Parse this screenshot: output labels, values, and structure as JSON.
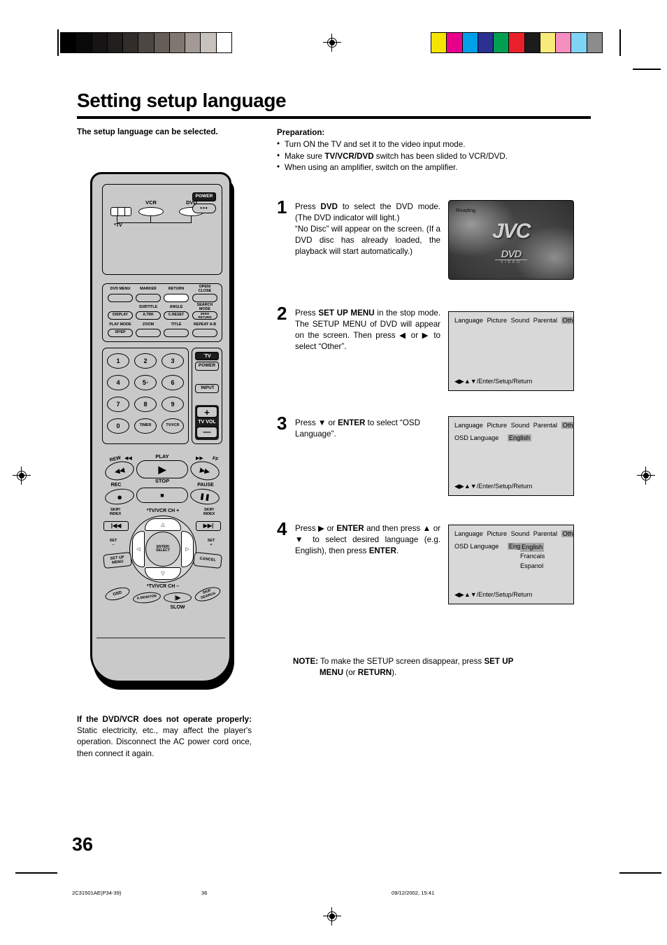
{
  "page": {
    "title": "Setting setup language",
    "subtitle": "The setup language can be selected.",
    "number": "36"
  },
  "preparation": {
    "heading": "Preparation:",
    "items": [
      "Turn ON the TV and set it to the video input mode.",
      "Make sure TV/VCR/DVD switch has been slided to VCR/DVD.",
      "When using an amplifier, switch on the amplifier."
    ]
  },
  "steps": [
    {
      "number": "1",
      "text": "Press DVD to select the DVD mode. (The DVD indicator will light.) “No Disc” will appear on the screen. (If a DVD disc has already loaded, the playback will start automatically.)"
    },
    {
      "number": "2",
      "text": "Press SET UP MENU in the stop mode. The SETUP MENU of DVD will appear on the screen. Then press ◀ or ▶ to select “Other”."
    },
    {
      "number": "3",
      "text": "Press ▼ or ENTER to select “OSD Language”."
    },
    {
      "number": "4",
      "text": "Press ▶ or ENTER and then press ▲ or ▼ to select desired language (e.g. English), then press ENTER."
    }
  ],
  "screens": {
    "reading": {
      "status": "Reading",
      "brand": "JVC",
      "logo": "DVD",
      "logo_sub": "VIDEO"
    },
    "menu_tabs": [
      "Language",
      "Picture",
      "Sound",
      "Parental",
      "Other"
    ],
    "selected_tab": "Other",
    "osd_label": "OSD Language",
    "osd_value": "English",
    "footer_hint": "◀▶▲▼/Enter/Setup/Return",
    "language_options": [
      "English",
      "Francais",
      "Espanol"
    ],
    "selected_language": "English"
  },
  "note": {
    "label": "NOTE:",
    "line1": "To make the SETUP screen disappear, press SET UP",
    "line2": "MENU (or RETURN)."
  },
  "troubleshooting": {
    "heading": "If the DVD/VCR does not operate properly:",
    "text": " Static electricity, etc., may affect the player's operation. Disconnect the AC power cord once, then connect it again."
  },
  "remote": {
    "mode_buttons": [
      "VCR",
      "DVD"
    ],
    "power_label": "POWER",
    "tv_slider_label": "*TV",
    "top_row": [
      "DVD MENU",
      "MARKER",
      "RETURN",
      "OPEN/ CLOSE"
    ],
    "row2_labels": [
      "SUBTITLE",
      "ANGLE",
      "SEARCH MODE"
    ],
    "row2_buttons": [
      "DISPLAY",
      "A.TRK",
      "C.RESET",
      "ZERO RETURN"
    ],
    "row3_labels": [
      "PLAY MODE",
      "ZOOM",
      "TITLE",
      "REPEAT A-B"
    ],
    "row3_buttons": [
      "SP/EP"
    ],
    "numbers": [
      "1",
      "2",
      "3",
      "4",
      "5",
      "6",
      "7",
      "8",
      "9",
      "0",
      "TIMER",
      "TV/VCR"
    ],
    "tv_block": [
      "˙TV",
      "POWER",
      "˙INPUT",
      "+",
      "TV VOL",
      "—"
    ],
    "transport_labels": [
      "REW",
      "PLAY",
      "FF",
      "REC",
      "STOP",
      "PAUSE"
    ],
    "skip_labels": [
      "SKIP/ INDEX",
      "SKIP/ INDEX"
    ],
    "set_labels": [
      "SET –",
      "SET +"
    ],
    "dpad": {
      "top_label": "*TV/VCR CH +",
      "bottom_label": "*TV/VCR CH –",
      "center": "ENTER/ SELECT"
    },
    "bottom_buttons": [
      "SET UP MENU",
      "CANCEL",
      "OSD",
      "A.MONITOR",
      "SLOW",
      "SKIP SEARCH"
    ]
  },
  "footer": {
    "doc_id": "2C31501AE(P34-39)",
    "page": "36",
    "timestamp": "09/12/2002, 15:41"
  },
  "colors": {
    "gray_scale": [
      "#000000",
      "#0a0a0a",
      "#161414",
      "#211f1d",
      "#312d2a",
      "#4d4743",
      "#655d58",
      "#817771",
      "#a39a95",
      "#c8c2bd",
      "#ffffff"
    ],
    "color_bars": [
      "#f5e400",
      "#e8008c",
      "#00a0e9",
      "#2b3190",
      "#00a050",
      "#e8202a",
      "#1c1c1c",
      "#f8eb7a",
      "#f58fc0",
      "#7fd4f5",
      "#8c8c8c"
    ],
    "highlight": "#a6a6a6"
  }
}
